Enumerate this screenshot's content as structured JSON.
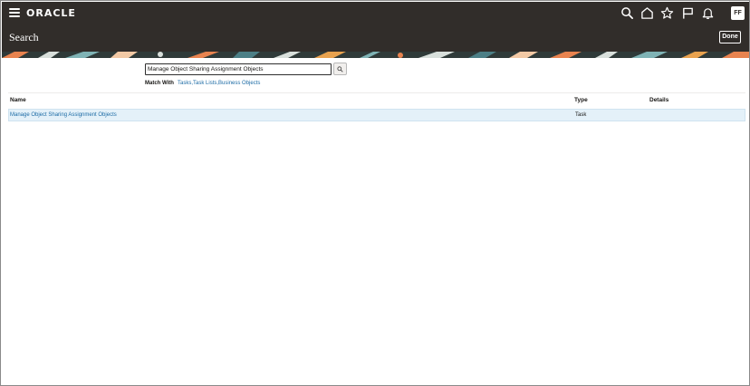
{
  "header": {
    "logo_text": "ORACLE",
    "user_initials": "FF",
    "icons": [
      "menu-icon",
      "search-icon",
      "home-icon",
      "star-icon",
      "flag-icon",
      "bell-icon"
    ]
  },
  "title_bar": {
    "title": "Search",
    "done_label": "Done"
  },
  "search": {
    "query": "Manage Object Sharing Assignment Objects"
  },
  "match_with": {
    "label": "Match With",
    "options": [
      "Tasks",
      "Task Lists",
      "Business Objects"
    ]
  },
  "results": {
    "columns": [
      "Name",
      "Type",
      "Details"
    ],
    "rows": [
      {
        "name": "Manage Object Sharing Assignment Objects",
        "type": "Task",
        "details": ""
      }
    ]
  },
  "colors": {
    "header_bg": "#312d2a",
    "link": "#1c6ba5",
    "selected_row": "#e4f1f9"
  }
}
